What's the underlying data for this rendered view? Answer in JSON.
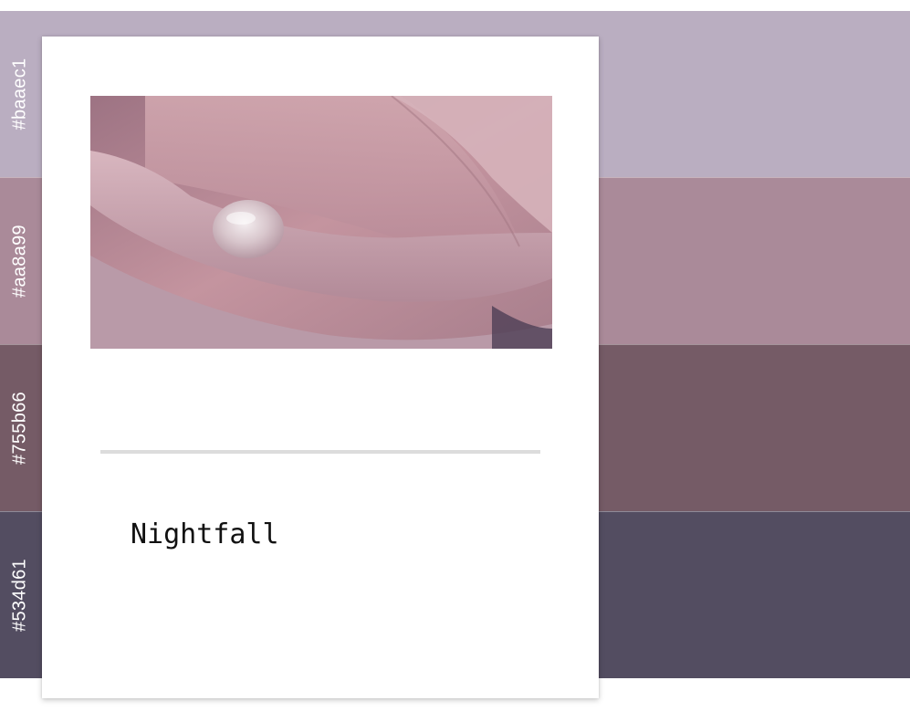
{
  "palette": {
    "colors": [
      {
        "label": "#baaec1",
        "hex": "#baaec1"
      },
      {
        "label": "#aa8a99",
        "hex": "#aa8a99"
      },
      {
        "label": "#755b66",
        "hex": "#755b66"
      },
      {
        "label": "#534d61",
        "hex": "#534d61"
      }
    ]
  },
  "card": {
    "title": "Nightfall",
    "photo_subject": "pink rose petal with water droplet"
  }
}
